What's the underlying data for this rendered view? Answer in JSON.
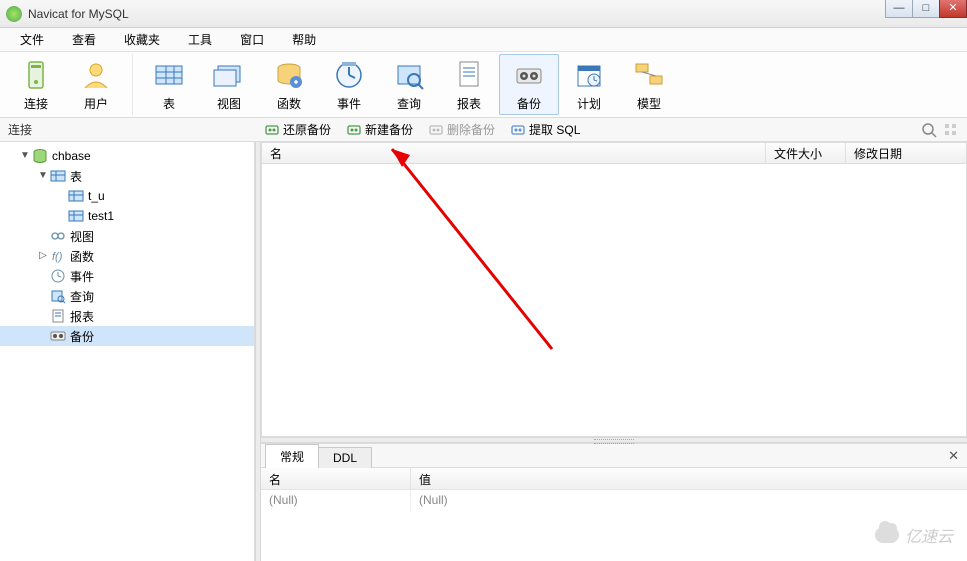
{
  "window": {
    "title": "Navicat for MySQL"
  },
  "menubar": {
    "items": [
      "文件",
      "查看",
      "收藏夹",
      "工具",
      "窗口",
      "帮助"
    ]
  },
  "toolbar": {
    "groups": [
      [
        {
          "label": "连接",
          "icon": "connection"
        },
        {
          "label": "用户",
          "icon": "user"
        }
      ],
      [
        {
          "label": "表",
          "icon": "table"
        },
        {
          "label": "视图",
          "icon": "view"
        },
        {
          "label": "函数",
          "icon": "function"
        },
        {
          "label": "事件",
          "icon": "event"
        },
        {
          "label": "查询",
          "icon": "query"
        },
        {
          "label": "报表",
          "icon": "report"
        },
        {
          "label": "备份",
          "icon": "backup",
          "active": true
        },
        {
          "label": "计划",
          "icon": "schedule"
        },
        {
          "label": "模型",
          "icon": "model"
        }
      ]
    ]
  },
  "subbar": {
    "left_label": "连接",
    "actions": [
      {
        "label": "还原备份",
        "icon": "restore"
      },
      {
        "label": "新建备份",
        "icon": "new-backup"
      },
      {
        "label": "删除备份",
        "icon": "delete-backup",
        "disabled": true
      },
      {
        "label": "提取 SQL",
        "icon": "extract-sql"
      }
    ]
  },
  "tree": {
    "nodes": [
      {
        "label": "chbase",
        "icon": "database",
        "indent": 1,
        "expanded": true,
        "toggle": "▼"
      },
      {
        "label": "表",
        "icon": "tables",
        "indent": 2,
        "expanded": true,
        "toggle": "▼"
      },
      {
        "label": "t_u",
        "icon": "table-leaf",
        "indent": 3,
        "toggle": ""
      },
      {
        "label": "test1",
        "icon": "table-leaf",
        "indent": 3,
        "toggle": ""
      },
      {
        "label": "视图",
        "icon": "view-leaf",
        "indent": 2,
        "toggle": ""
      },
      {
        "label": "函数",
        "icon": "func-leaf",
        "indent": 2,
        "toggle": "▷"
      },
      {
        "label": "事件",
        "icon": "event-leaf",
        "indent": 2,
        "toggle": ""
      },
      {
        "label": "查询",
        "icon": "query-leaf",
        "indent": 2,
        "toggle": ""
      },
      {
        "label": "报表",
        "icon": "report-leaf",
        "indent": 2,
        "toggle": ""
      },
      {
        "label": "备份",
        "icon": "backup-leaf",
        "indent": 2,
        "toggle": "",
        "selected": true
      }
    ]
  },
  "list": {
    "columns": [
      "名",
      "文件大小",
      "修改日期"
    ]
  },
  "bottom": {
    "tabs": [
      "常规",
      "DDL"
    ],
    "active_tab": "常规",
    "columns": [
      "名",
      "值"
    ],
    "row": {
      "name": "(Null)",
      "value": "(Null)"
    }
  },
  "watermark": "亿速云"
}
